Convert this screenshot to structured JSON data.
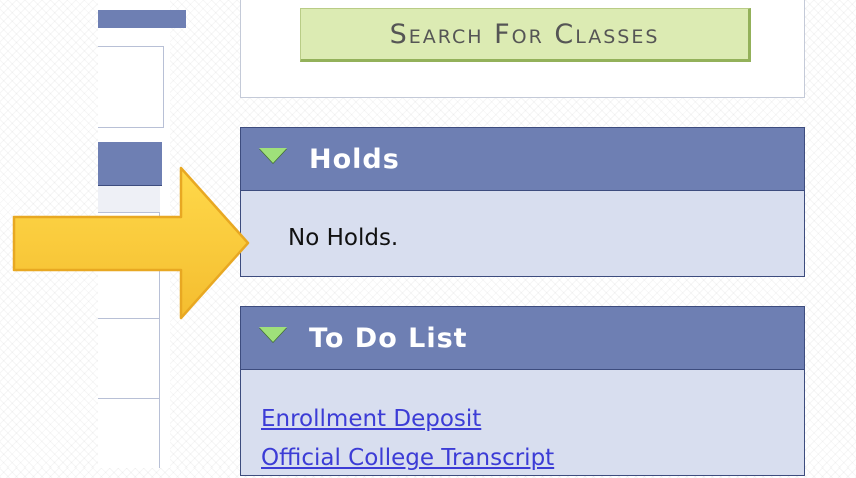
{
  "search": {
    "button_label": "Search For Classes"
  },
  "holds": {
    "title": "Holds",
    "message": "No Holds."
  },
  "todo": {
    "title": "To Do List",
    "items": [
      {
        "label": "Enrollment Deposit"
      },
      {
        "label": "Official College Transcript"
      }
    ]
  },
  "icons": {
    "section_toggle": "triangle-down-icon",
    "callout": "arrow-right-icon"
  },
  "colors": {
    "header_bg": "#6e7fb3",
    "body_bg": "#d8deef",
    "button_bg": "#dcebb3",
    "link": "#3c3cd6",
    "arrow": "#f6c53a"
  }
}
